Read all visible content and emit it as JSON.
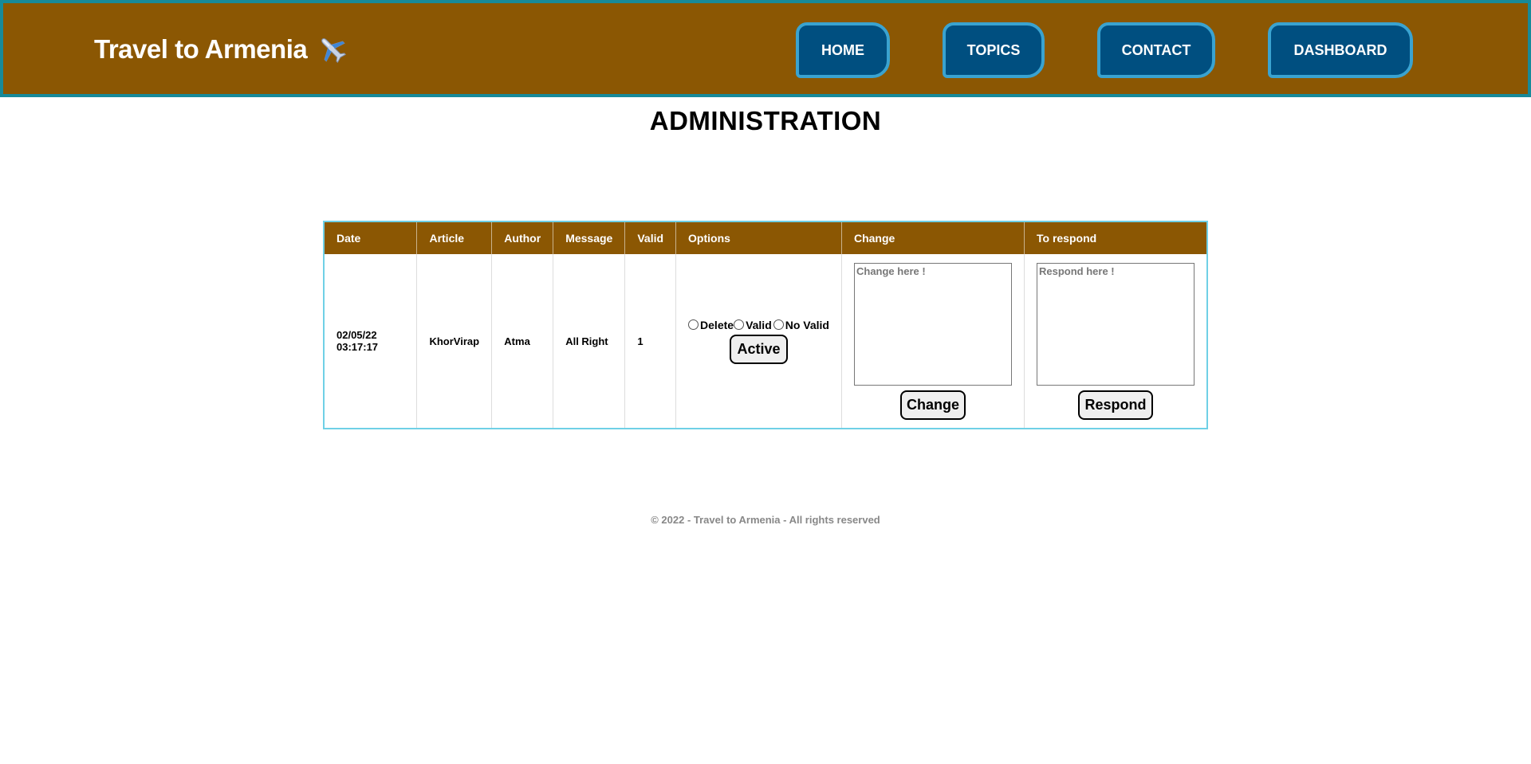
{
  "header": {
    "brand": "Travel to Armenia",
    "brand_icon": "airplane-icon",
    "nav": [
      {
        "label": "HOME"
      },
      {
        "label": "TOPICS"
      },
      {
        "label": "CONTACT"
      },
      {
        "label": "DASHBOARD"
      }
    ]
  },
  "page_title": "ADMINISTRATION",
  "table": {
    "headers": [
      "Date",
      "Article",
      "Author",
      "Message",
      "Valid",
      "Options",
      "Change",
      "To respond"
    ],
    "rows": [
      {
        "date": "02/05/22 03:17:17",
        "article": "KhorVirap",
        "author": "Atma",
        "message": "All Right",
        "valid": "1",
        "options": {
          "radios": [
            "Delete",
            "Valid",
            "No Valid"
          ],
          "active_label": "Active"
        },
        "change": {
          "placeholder": "Change here !",
          "button": "Change"
        },
        "respond": {
          "placeholder": "Respond here !",
          "button": "Respond"
        }
      }
    ]
  },
  "footer": "© 2022 - Travel to Armenia - All rights reserved",
  "colors": {
    "header_bg": "#8b5703",
    "header_border": "#178a99",
    "nav_bg": "#004f80",
    "nav_border": "#3aa3d0",
    "table_border": "#6fd0e6"
  }
}
